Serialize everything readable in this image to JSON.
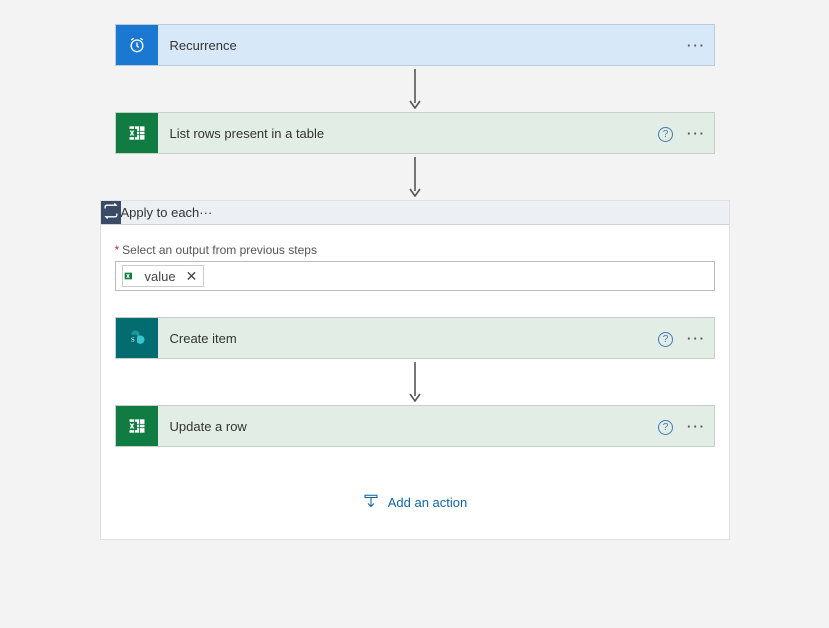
{
  "steps": {
    "recurrence": {
      "label": "Recurrence"
    },
    "listRows": {
      "label": "List rows present in a table"
    },
    "applyEach": {
      "label": "Apply to each"
    },
    "createItem": {
      "label": "Create item"
    },
    "updateRow": {
      "label": "Update a row"
    }
  },
  "applyEach": {
    "fieldLabel": "Select an output from previous steps",
    "token": {
      "label": "value"
    }
  },
  "addActionLabel": "Add an action"
}
